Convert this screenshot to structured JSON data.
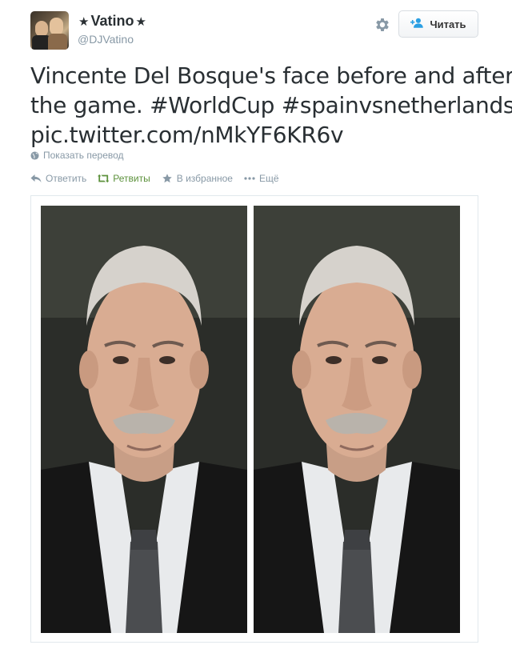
{
  "user": {
    "display_name": "Vatino",
    "star_left": "★",
    "star_right": "★",
    "handle": "@DJVatino"
  },
  "header": {
    "follow_label": "Читать"
  },
  "tweet": {
    "text_lines": [
      "Vincente Del Bosque's face before and after",
      "the game. #WorldCup #spainvsnetherlands",
      "pic.twitter.com/nMkYF6KR6v"
    ],
    "translate_label": "Показать перевод"
  },
  "actions": {
    "reply_label": "Ответить",
    "retweet_label": "Ретвиты",
    "favorite_label": "В избранное",
    "more_label": "Ещё"
  },
  "colors": {
    "text": "#292f33",
    "muted": "#8899a6",
    "retweet_green": "#5c913b",
    "follow_blue": "#2a9fe3"
  },
  "icons": [
    "gear-icon",
    "add-user-icon",
    "globe-icon",
    "reply-icon",
    "retweet-icon",
    "star-icon",
    "more-icon"
  ]
}
